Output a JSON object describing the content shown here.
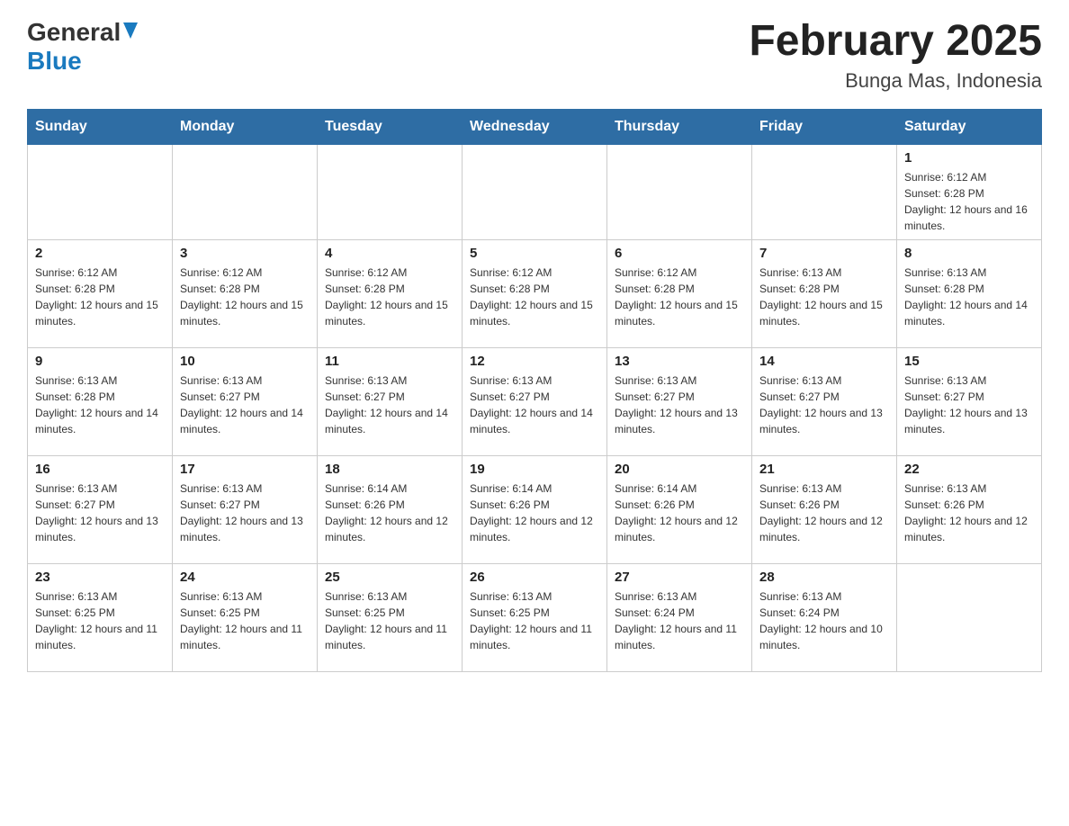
{
  "header": {
    "logo_general": "General",
    "logo_blue": "Blue",
    "title": "February 2025",
    "subtitle": "Bunga Mas, Indonesia"
  },
  "days_of_week": [
    "Sunday",
    "Monday",
    "Tuesday",
    "Wednesday",
    "Thursday",
    "Friday",
    "Saturday"
  ],
  "weeks": [
    [
      {
        "day": "",
        "info": ""
      },
      {
        "day": "",
        "info": ""
      },
      {
        "day": "",
        "info": ""
      },
      {
        "day": "",
        "info": ""
      },
      {
        "day": "",
        "info": ""
      },
      {
        "day": "",
        "info": ""
      },
      {
        "day": "1",
        "info": "Sunrise: 6:12 AM\nSunset: 6:28 PM\nDaylight: 12 hours and 16 minutes."
      }
    ],
    [
      {
        "day": "2",
        "info": "Sunrise: 6:12 AM\nSunset: 6:28 PM\nDaylight: 12 hours and 15 minutes."
      },
      {
        "day": "3",
        "info": "Sunrise: 6:12 AM\nSunset: 6:28 PM\nDaylight: 12 hours and 15 minutes."
      },
      {
        "day": "4",
        "info": "Sunrise: 6:12 AM\nSunset: 6:28 PM\nDaylight: 12 hours and 15 minutes."
      },
      {
        "day": "5",
        "info": "Sunrise: 6:12 AM\nSunset: 6:28 PM\nDaylight: 12 hours and 15 minutes."
      },
      {
        "day": "6",
        "info": "Sunrise: 6:12 AM\nSunset: 6:28 PM\nDaylight: 12 hours and 15 minutes."
      },
      {
        "day": "7",
        "info": "Sunrise: 6:13 AM\nSunset: 6:28 PM\nDaylight: 12 hours and 15 minutes."
      },
      {
        "day": "8",
        "info": "Sunrise: 6:13 AM\nSunset: 6:28 PM\nDaylight: 12 hours and 14 minutes."
      }
    ],
    [
      {
        "day": "9",
        "info": "Sunrise: 6:13 AM\nSunset: 6:28 PM\nDaylight: 12 hours and 14 minutes."
      },
      {
        "day": "10",
        "info": "Sunrise: 6:13 AM\nSunset: 6:27 PM\nDaylight: 12 hours and 14 minutes."
      },
      {
        "day": "11",
        "info": "Sunrise: 6:13 AM\nSunset: 6:27 PM\nDaylight: 12 hours and 14 minutes."
      },
      {
        "day": "12",
        "info": "Sunrise: 6:13 AM\nSunset: 6:27 PM\nDaylight: 12 hours and 14 minutes."
      },
      {
        "day": "13",
        "info": "Sunrise: 6:13 AM\nSunset: 6:27 PM\nDaylight: 12 hours and 13 minutes."
      },
      {
        "day": "14",
        "info": "Sunrise: 6:13 AM\nSunset: 6:27 PM\nDaylight: 12 hours and 13 minutes."
      },
      {
        "day": "15",
        "info": "Sunrise: 6:13 AM\nSunset: 6:27 PM\nDaylight: 12 hours and 13 minutes."
      }
    ],
    [
      {
        "day": "16",
        "info": "Sunrise: 6:13 AM\nSunset: 6:27 PM\nDaylight: 12 hours and 13 minutes."
      },
      {
        "day": "17",
        "info": "Sunrise: 6:13 AM\nSunset: 6:27 PM\nDaylight: 12 hours and 13 minutes."
      },
      {
        "day": "18",
        "info": "Sunrise: 6:14 AM\nSunset: 6:26 PM\nDaylight: 12 hours and 12 minutes."
      },
      {
        "day": "19",
        "info": "Sunrise: 6:14 AM\nSunset: 6:26 PM\nDaylight: 12 hours and 12 minutes."
      },
      {
        "day": "20",
        "info": "Sunrise: 6:14 AM\nSunset: 6:26 PM\nDaylight: 12 hours and 12 minutes."
      },
      {
        "day": "21",
        "info": "Sunrise: 6:13 AM\nSunset: 6:26 PM\nDaylight: 12 hours and 12 minutes."
      },
      {
        "day": "22",
        "info": "Sunrise: 6:13 AM\nSunset: 6:26 PM\nDaylight: 12 hours and 12 minutes."
      }
    ],
    [
      {
        "day": "23",
        "info": "Sunrise: 6:13 AM\nSunset: 6:25 PM\nDaylight: 12 hours and 11 minutes."
      },
      {
        "day": "24",
        "info": "Sunrise: 6:13 AM\nSunset: 6:25 PM\nDaylight: 12 hours and 11 minutes."
      },
      {
        "day": "25",
        "info": "Sunrise: 6:13 AM\nSunset: 6:25 PM\nDaylight: 12 hours and 11 minutes."
      },
      {
        "day": "26",
        "info": "Sunrise: 6:13 AM\nSunset: 6:25 PM\nDaylight: 12 hours and 11 minutes."
      },
      {
        "day": "27",
        "info": "Sunrise: 6:13 AM\nSunset: 6:24 PM\nDaylight: 12 hours and 11 minutes."
      },
      {
        "day": "28",
        "info": "Sunrise: 6:13 AM\nSunset: 6:24 PM\nDaylight: 12 hours and 10 minutes."
      },
      {
        "day": "",
        "info": ""
      }
    ]
  ]
}
